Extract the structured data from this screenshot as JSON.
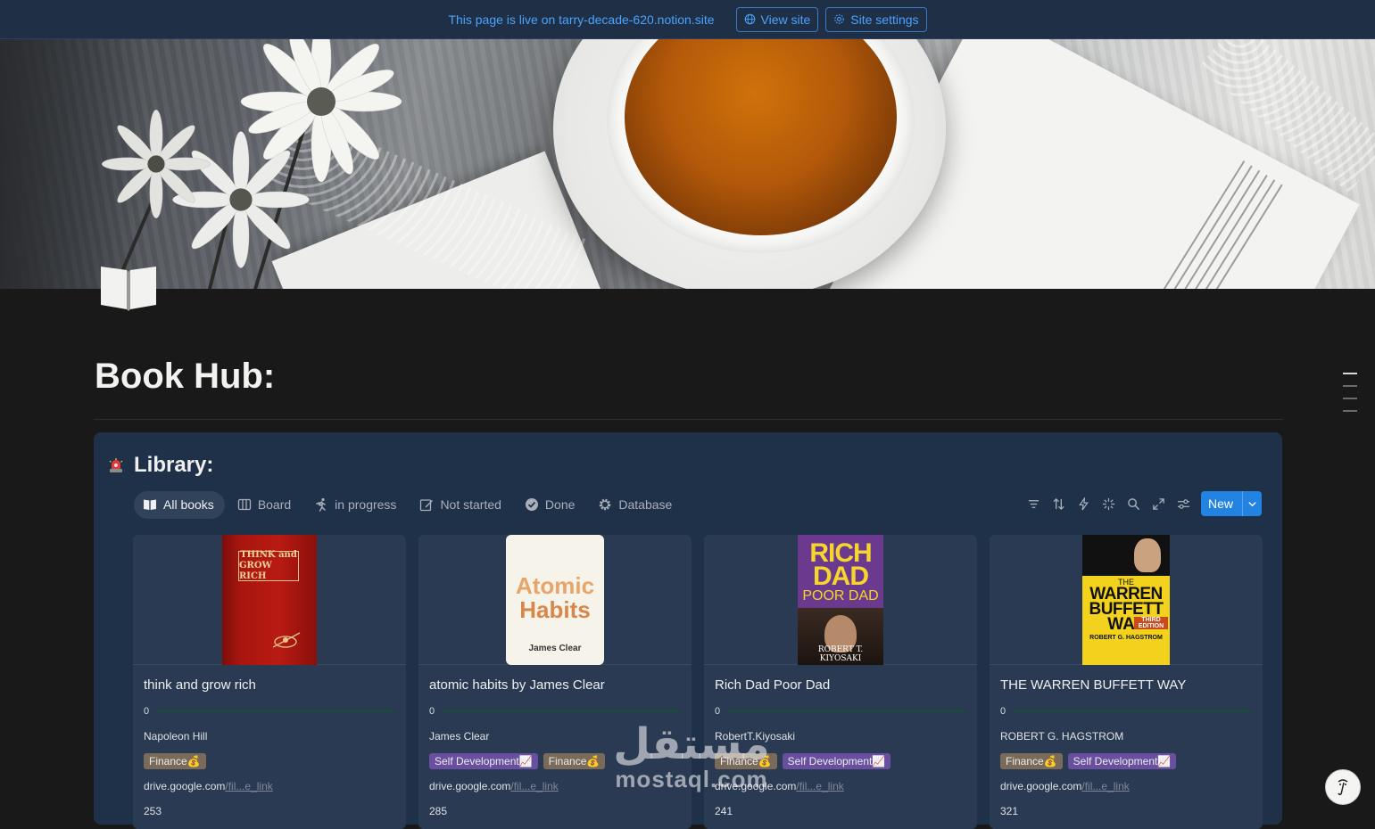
{
  "topbar": {
    "live_text": "This page is live on tarry-decade-620.notion.site",
    "view_site": "View site",
    "site_settings": "Site settings",
    "accent": "#4aa3ff"
  },
  "page": {
    "icon": "open-book-icon",
    "title": "Book Hub:"
  },
  "library": {
    "icon": "siren-icon",
    "title": "Library:",
    "tabs": [
      {
        "label": "All books",
        "icon": "book-icon",
        "active": true
      },
      {
        "label": "Board",
        "icon": "board-icon",
        "active": false
      },
      {
        "label": "in progress",
        "icon": "running-icon",
        "active": false
      },
      {
        "label": "Not started",
        "icon": "edit-icon",
        "active": false
      },
      {
        "label": "Done",
        "icon": "check-circle-icon",
        "active": false
      },
      {
        "label": "Database",
        "icon": "gear-icon",
        "active": false
      }
    ],
    "tools": [
      "filter-icon",
      "sort-icon",
      "lightning-icon",
      "sparkle-icon",
      "search-icon",
      "expand-icon",
      "settings-sliders-icon"
    ],
    "new_label": "New"
  },
  "cards": [
    {
      "title": "think and grow rich",
      "progress": 0,
      "author": "Napoleon Hill",
      "tags": [
        {
          "label": "Finance💰",
          "type": "finance"
        }
      ],
      "link_host": "drive.google.com",
      "link_rest": "/fil...e_link",
      "pages": "253",
      "cover": {
        "line1": "THINK and",
        "line2": "GROW RICH"
      }
    },
    {
      "title": "atomic habits by James Clear",
      "progress": 0,
      "author": "James Clear",
      "tags": [
        {
          "label": "Self Development📈",
          "type": "selfdev"
        },
        {
          "label": "Finance💰",
          "type": "finance"
        }
      ],
      "link_host": "drive.google.com",
      "link_rest": "/fil...e_link",
      "pages": "285",
      "cover": {
        "line1": "Atomic",
        "line2": "Habits",
        "author": "James Clear"
      }
    },
    {
      "title": "Rich Dad Poor Dad",
      "progress": 0,
      "author": "RobertT.Kiyosaki",
      "tags": [
        {
          "label": "Finance💰",
          "type": "finance"
        },
        {
          "label": "Self Development📈",
          "type": "selfdev"
        }
      ],
      "link_host": "drive.google.com",
      "link_rest": "/fil...e_link",
      "pages": "241",
      "cover": {
        "line1": "RICH",
        "line2": "DAD",
        "line3": "POOR DAD",
        "author": "ROBERT T. KIYOSAKI"
      }
    },
    {
      "title": "THE WARREN BUFFETT WAY",
      "progress": 0,
      "author": "ROBERT G. HAGSTROM",
      "tags": [
        {
          "label": "Finance💰",
          "type": "finance"
        },
        {
          "label": "Self Development📈",
          "type": "selfdev"
        }
      ],
      "link_host": "drive.google.com",
      "link_rest": "/fil...e_link",
      "pages": "321",
      "cover": {
        "line1": "THE",
        "line2": "WARREN",
        "line3": "BUFFETT",
        "line4": "WAY",
        "edition": "THIRD EDITION",
        "author": "ROBERT G. HAGSTROM"
      }
    }
  ],
  "watermark": {
    "ar": "مستقل",
    "en": "mostaql.com"
  }
}
